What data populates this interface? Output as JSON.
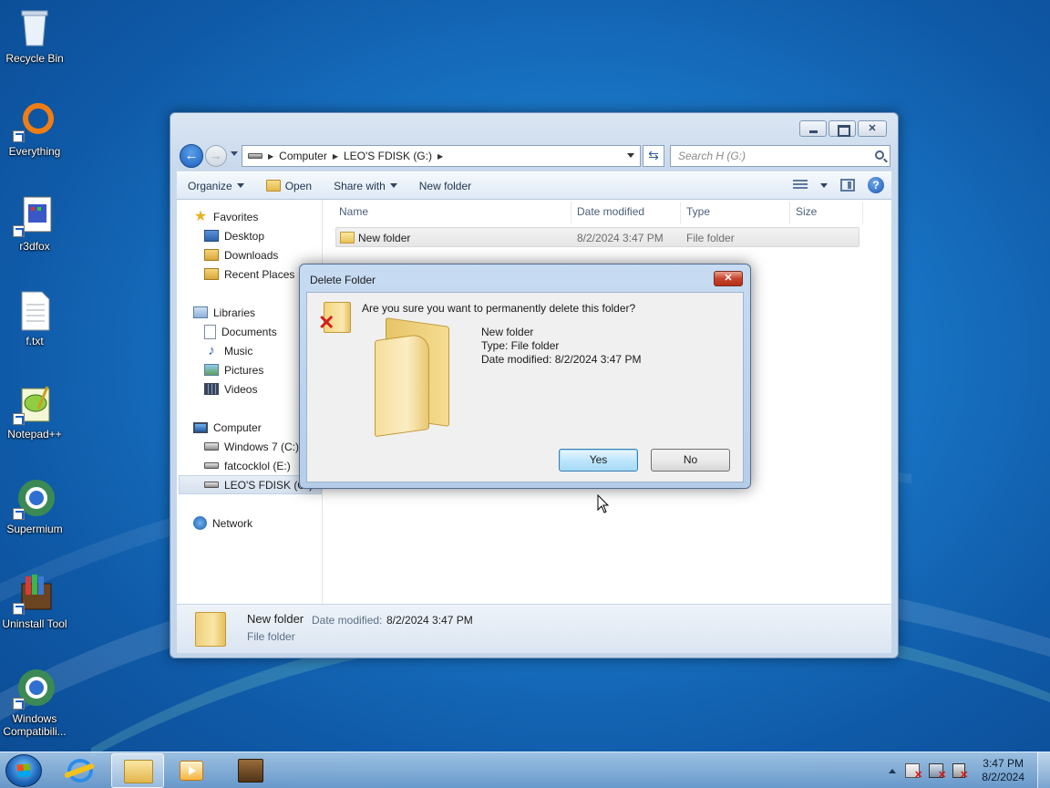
{
  "desktop": {
    "icons": [
      {
        "label": "Recycle Bin",
        "icon": "recycle-bin-icon"
      },
      {
        "label": "Everything",
        "icon": "everything-icon"
      },
      {
        "label": "r3dfox",
        "icon": "r3dfox-icon"
      },
      {
        "label": "f.txt",
        "icon": "text-file-icon"
      },
      {
        "label": "Notepad++",
        "icon": "notepad-plus-plus-icon"
      },
      {
        "label": "Supermium",
        "icon": "supermium-icon"
      },
      {
        "label": "Uninstall Tool",
        "icon": "uninstall-tool-icon"
      },
      {
        "label": "Windows Compatibili...",
        "icon": "windows-compat-icon"
      }
    ]
  },
  "explorer": {
    "breadcrumb": [
      "Computer",
      "LEO'S FDISK (G:)"
    ],
    "search_placeholder": "Search H (G:)",
    "toolbar": {
      "organize": "Organize",
      "open": "Open",
      "share_with": "Share with",
      "new_folder": "New folder"
    },
    "nav": {
      "favorites": "Favorites",
      "desktop": "Desktop",
      "downloads": "Downloads",
      "recent": "Recent Places",
      "libraries": "Libraries",
      "documents": "Documents",
      "music": "Music",
      "pictures": "Pictures",
      "videos": "Videos",
      "computer": "Computer",
      "drive_c": "Windows 7 (C:)",
      "drive_e": "fatcocklol (E:)",
      "drive_g": "LEO'S FDISK (G:)",
      "network": "Network"
    },
    "columns": {
      "name": "Name",
      "date": "Date modified",
      "type": "Type",
      "size": "Size"
    },
    "files": [
      {
        "name": "New folder",
        "date": "8/2/2024 3:47 PM",
        "type": "File folder",
        "size": ""
      }
    ],
    "details": {
      "name": "New folder",
      "date_label": "Date modified:",
      "date": "8/2/2024 3:47 PM",
      "type": "File folder"
    }
  },
  "dialog": {
    "title": "Delete Folder",
    "question": "Are you sure you want to permanently delete this folder?",
    "item_name": "New folder",
    "item_type": "Type: File folder",
    "item_date": "Date modified: 8/2/2024 3:47 PM",
    "yes": "Yes",
    "no": "No"
  },
  "taskbar": {
    "time": "3:47 PM",
    "date": "8/2/2024",
    "active_app": "Windows Explorer"
  }
}
